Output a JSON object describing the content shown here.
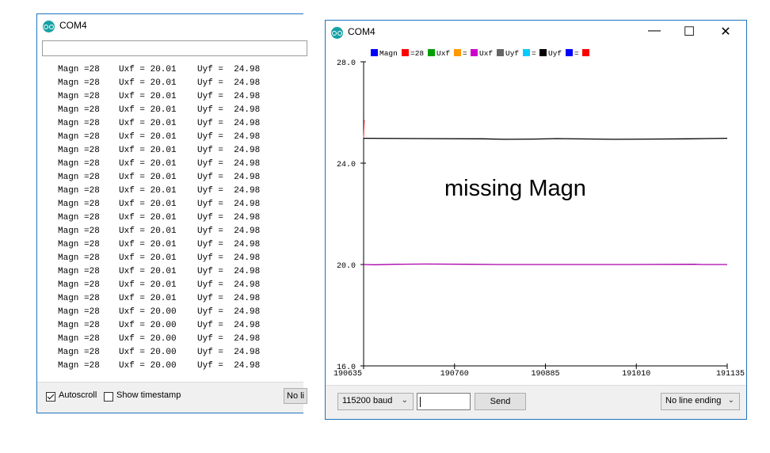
{
  "serial_monitor": {
    "title": "COM4",
    "command_value": "",
    "lines": [
      {
        "m": "Magn =28",
        "x": "Uxf = 20.01",
        "y": "Uyf =  24.98"
      },
      {
        "m": "Magn =28",
        "x": "Uxf = 20.01",
        "y": "Uyf =  24.98"
      },
      {
        "m": "Magn =28",
        "x": "Uxf = 20.01",
        "y": "Uyf =  24.98"
      },
      {
        "m": "Magn =28",
        "x": "Uxf = 20.01",
        "y": "Uyf =  24.98"
      },
      {
        "m": "Magn =28",
        "x": "Uxf = 20.01",
        "y": "Uyf =  24.98"
      },
      {
        "m": "Magn =28",
        "x": "Uxf = 20.01",
        "y": "Uyf =  24.98"
      },
      {
        "m": "Magn =28",
        "x": "Uxf = 20.01",
        "y": "Uyf =  24.98"
      },
      {
        "m": "Magn =28",
        "x": "Uxf = 20.01",
        "y": "Uyf =  24.98"
      },
      {
        "m": "Magn =28",
        "x": "Uxf = 20.01",
        "y": "Uyf =  24.98"
      },
      {
        "m": "Magn =28",
        "x": "Uxf = 20.01",
        "y": "Uyf =  24.98"
      },
      {
        "m": "Magn =28",
        "x": "Uxf = 20.01",
        "y": "Uyf =  24.98"
      },
      {
        "m": "Magn =28",
        "x": "Uxf = 20.01",
        "y": "Uyf =  24.98"
      },
      {
        "m": "Magn =28",
        "x": "Uxf = 20.01",
        "y": "Uyf =  24.98"
      },
      {
        "m": "Magn =28",
        "x": "Uxf = 20.01",
        "y": "Uyf =  24.98"
      },
      {
        "m": "Magn =28",
        "x": "Uxf = 20.01",
        "y": "Uyf =  24.98"
      },
      {
        "m": "Magn =28",
        "x": "Uxf = 20.01",
        "y": "Uyf =  24.98"
      },
      {
        "m": "Magn =28",
        "x": "Uxf = 20.01",
        "y": "Uyf =  24.98"
      },
      {
        "m": "Magn =28",
        "x": "Uxf = 20.01",
        "y": "Uyf =  24.98"
      },
      {
        "m": "Magn =28",
        "x": "Uxf = 20.00",
        "y": "Uyf =  24.98"
      },
      {
        "m": "Magn =28",
        "x": "Uxf = 20.00",
        "y": "Uyf =  24.98"
      },
      {
        "m": "Magn =28",
        "x": "Uxf = 20.00",
        "y": "Uyf =  24.98"
      },
      {
        "m": "Magn =28",
        "x": "Uxf = 20.00",
        "y": "Uyf =  24.98"
      },
      {
        "m": "Magn =28",
        "x": "Uxf = 20.00",
        "y": "Uyf =  24.98"
      }
    ],
    "autoscroll_label": "Autoscroll",
    "autoscroll_checked": true,
    "timestamp_label": "Show timestamp",
    "timestamp_checked": false,
    "line_ending_truncated": "No li"
  },
  "plotter": {
    "title": "COM4",
    "window_controls": {
      "minimize": "—",
      "maximize": "☐",
      "close": "✕"
    },
    "annotation": "missing Magn",
    "baud_label": "115200 baud",
    "send_input_value": "",
    "send_label": "Send",
    "line_ending_label": "No line ending",
    "colors": {
      "accent": "#1e73be"
    }
  },
  "chart_data": {
    "type": "line",
    "ylim": [
      16.0,
      28.0
    ],
    "xlim": [
      190635,
      191135
    ],
    "y_ticks": [
      "28.0",
      "24.0",
      "20.0",
      "16.0"
    ],
    "y_tick_values": [
      28,
      24,
      20,
      16
    ],
    "x_ticks": [
      "190635",
      "190760",
      "190885",
      "191010",
      "191135"
    ],
    "x_tick_values": [
      190635,
      190760,
      190885,
      191010,
      191135
    ],
    "legend": [
      {
        "text": "Magn",
        "color": "#0000ff"
      },
      {
        "text": "=28",
        "color": "#ff0000"
      },
      {
        "text": "Uxf",
        "color": "#00a000"
      },
      {
        "text": "=",
        "color": "#ff9900"
      },
      {
        "text": "Uxf",
        "color": "#cc00cc"
      },
      {
        "text": "Uyf",
        "color": "#666666"
      },
      {
        "text": "=",
        "color": "#00ccff"
      },
      {
        "text": "Uyf",
        "color": "#000000"
      },
      {
        "text": "=",
        "color": "#0000ff"
      },
      {
        "text": "",
        "color": "#ff0000"
      }
    ],
    "series": [
      {
        "color": "#000000",
        "x": [
          190635,
          190720,
          190800,
          190830,
          190870,
          190900,
          190980,
          191030,
          191080,
          191135
        ],
        "values": [
          24.98,
          24.97,
          24.96,
          24.94,
          24.95,
          24.97,
          24.94,
          24.95,
          24.96,
          24.98
        ]
      },
      {
        "color": "#aa00aa",
        "x": [
          190635,
          190650,
          190680,
          190720,
          190780,
          190820,
          190900,
          191000,
          191090,
          191100,
          191135
        ],
        "values": [
          20.0,
          19.99,
          20.01,
          20.02,
          20.01,
          20.0,
          20.0,
          20.0,
          20.01,
          20.0,
          20.0
        ]
      },
      {
        "color": "#ff4444",
        "x": [
          190635,
          190636
        ],
        "values": [
          25.0,
          25.7
        ]
      }
    ]
  }
}
